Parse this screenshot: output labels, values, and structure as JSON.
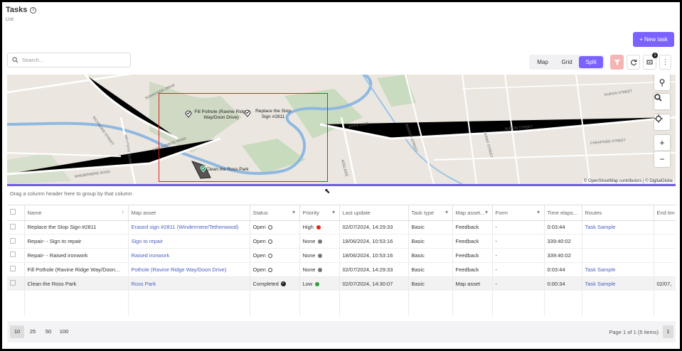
{
  "header": {
    "title": "Tasks",
    "subtitle": "List",
    "new_task_label": "+ New task"
  },
  "search": {
    "placeholder": "Search..."
  },
  "view_toggle": {
    "options": [
      "Map",
      "Grid",
      "Split"
    ],
    "active": "Split"
  },
  "toolbar": {
    "badge_count": "1",
    "icons": [
      "filter-icon",
      "refresh-icon",
      "layers-icon",
      "more-icon"
    ]
  },
  "map": {
    "streets": [
      "SUNNYSIDE DRIVE",
      "RICHMOND STREET",
      "WESTERN ROAD",
      "WINDERMERE ROAD",
      "WINDERMERE ROAD",
      "KIPPS LANE",
      "BARKER STREET",
      "ADELAIDE",
      "MCNAY STREET",
      "HURON STREET",
      "HURON STREET",
      "CHEAPSIDE STREET"
    ],
    "markers": [
      {
        "label": "Fill Pothole (Ravine Ridge Way/Doon Drive)"
      },
      {
        "label": "Replace the Stop Sign #2811"
      },
      {
        "label": "Clean the Ross Park"
      }
    ],
    "attribution": "© OpenStreetMap contributors | © DigitalGlobe",
    "controls": [
      "satellite-icon",
      "zoom-search-icon",
      "locate-icon",
      "zoom-in-icon",
      "zoom-out-icon"
    ]
  },
  "grid": {
    "group_hint": "Drag a column header here to group by that column",
    "columns": [
      "Name",
      "Map asset",
      "Status",
      "Priority",
      "Last update",
      "Task type",
      "Map asset...",
      "Form",
      "Time elaps...",
      "Routes",
      "End tim"
    ],
    "rows": [
      {
        "name": "Replace the Stop Sign #2811",
        "asset": "Erased sign #2811 (Windermere/Tetherwood)",
        "status": "Open",
        "priority": "High",
        "priority_color": "#e0261c",
        "last_update": "02/07/2024, 14:29:33",
        "task_type": "Basic",
        "asset_type": "Feedback",
        "form": "-",
        "elapsed": "0:03:44",
        "routes": "Task Sample",
        "end": ""
      },
      {
        "name": "Repair- - Sign to repair",
        "asset": "Sign to repair",
        "status": "Open",
        "priority": "None",
        "priority_color": "#777777",
        "last_update": "18/06/2024, 10:53:16",
        "task_type": "Basic",
        "asset_type": "Feedback",
        "form": "-",
        "elapsed": "339:40:02",
        "routes": "",
        "end": ""
      },
      {
        "name": "Repair- - Raised ironwork",
        "asset": "Raised ironwork",
        "status": "Open",
        "priority": "None",
        "priority_color": "#777777",
        "last_update": "18/06/2024, 10:53:16",
        "task_type": "Basic",
        "asset_type": "Feedback",
        "form": "-",
        "elapsed": "339:40:02",
        "routes": "",
        "end": ""
      },
      {
        "name": "Fill Pothole (Ravine Ridge Way/Doon...",
        "asset": "Pothole (Ravine Ridge Way/Doon Drive)",
        "status": "Open",
        "priority": "None",
        "priority_color": "#777777",
        "last_update": "02/07/2024, 14:29:33",
        "task_type": "Basic",
        "asset_type": "Feedback",
        "form": "-",
        "elapsed": "0:03:44",
        "routes": "Task Sample",
        "end": ""
      },
      {
        "name": "Clean the Ross Park",
        "asset": "Ross Park",
        "status": "Completed",
        "priority": "Low",
        "priority_color": "#2e9e3e",
        "last_update": "02/07/2024, 14:30:07",
        "task_type": "Basic",
        "asset_type": "Map asset",
        "form": "-",
        "elapsed": "0:00:34",
        "routes": "Task Sample",
        "end": "02/07,"
      }
    ]
  },
  "pager": {
    "sizes": [
      "10",
      "25",
      "50",
      "100"
    ],
    "active_size": "10",
    "info": "Page 1 of 1 (5 items)",
    "page": "1"
  }
}
